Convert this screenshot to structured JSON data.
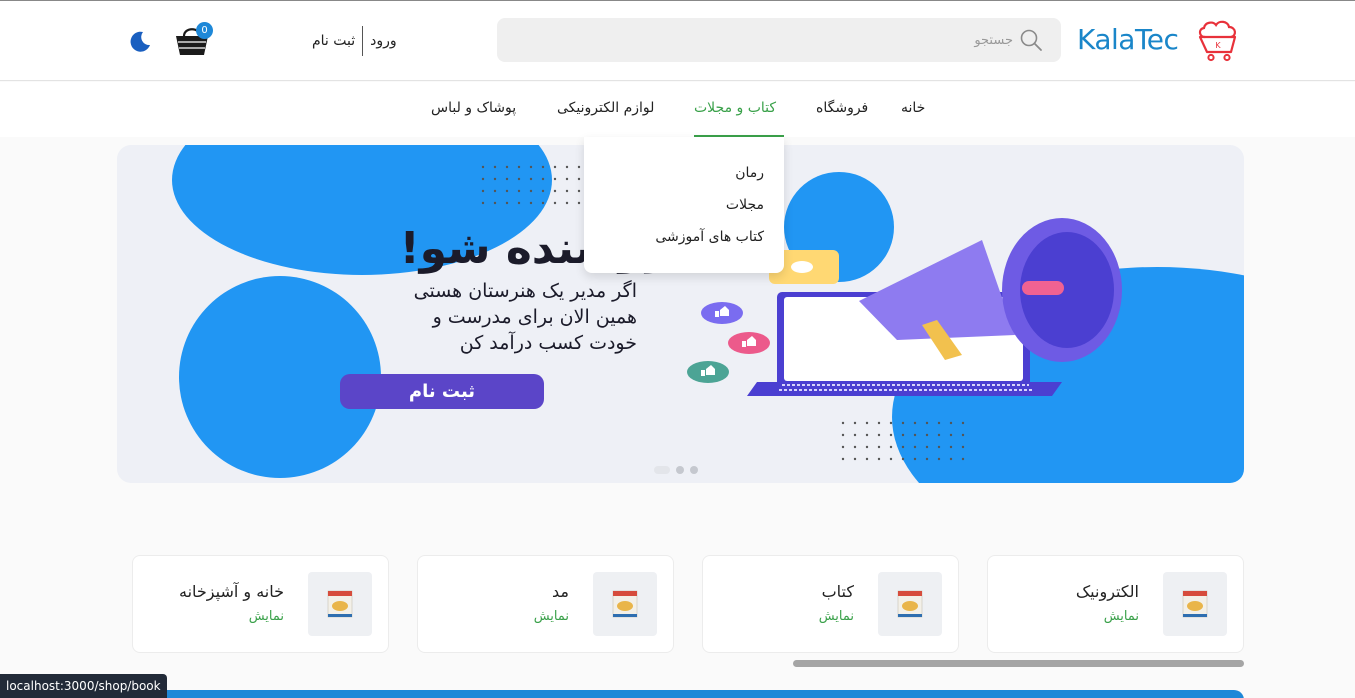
{
  "header": {
    "logo_text": "KalaTec",
    "logo_badge": "K",
    "search_placeholder": "جستجو",
    "login_label": "ورود",
    "register_label": "ثبت نام",
    "cart_count": "0",
    "theme_icon": "moon-icon"
  },
  "nav": {
    "items": [
      {
        "label": "خانه"
      },
      {
        "label": "فروشگاه"
      },
      {
        "label": "کتاب و مجلات",
        "active": true
      },
      {
        "label": "لوازم الکترونیکی"
      },
      {
        "label": "پوشاک و لباس"
      }
    ]
  },
  "dropdown": {
    "items": [
      {
        "label": "رمان"
      },
      {
        "label": "مجلات"
      },
      {
        "label": "کتاب های آموزشی"
      }
    ]
  },
  "banner": {
    "headline": "فروشنده شو!",
    "lines": [
      "اگر مدیر یک هنرستان هستی",
      "همین الان برای مدرست و",
      "خودت کسب درآمد کن"
    ],
    "cta_label": "ثبت نام",
    "slides": 3,
    "active_slide": 0
  },
  "categories": [
    {
      "title": "الکترونیک",
      "link": "نمایش"
    },
    {
      "title": "کتاب",
      "link": "نمایش"
    },
    {
      "title": "مد",
      "link": "نمایش"
    },
    {
      "title": "خانه و آشپزخانه",
      "link": "نمایش"
    }
  ],
  "status_bar": {
    "url": "localhost:3000/shop/book"
  },
  "colors": {
    "accent_green": "#3aa14a",
    "brand_blue": "#1a86c9",
    "cta_purple": "#5b45c8"
  }
}
